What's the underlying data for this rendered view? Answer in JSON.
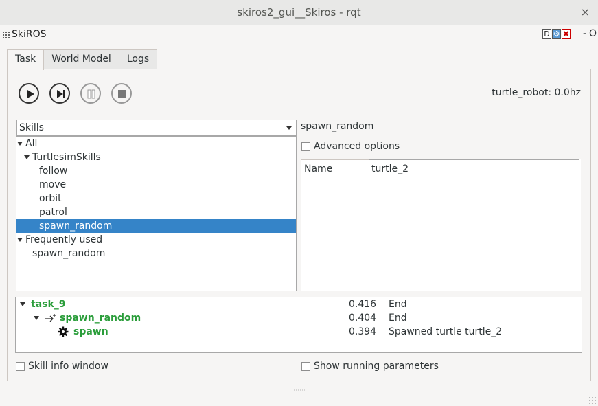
{
  "window": {
    "title": "skiros2_gui__Skiros - rqt",
    "close_glyph": "×"
  },
  "plugin": {
    "name": "SkiROS",
    "buttons": [
      "D",
      "⚙",
      "✖"
    ],
    "minimize_label": "-",
    "float_label": "O"
  },
  "tabs": [
    {
      "label": "Task",
      "active": true
    },
    {
      "label": "World Model",
      "active": false
    },
    {
      "label": "Logs",
      "active": false
    }
  ],
  "controls": {
    "play": "play-icon",
    "step": "step-forward-icon",
    "pause": "pause-icon",
    "stop": "stop-icon",
    "robot_status": "turtle_robot: 0.0hz"
  },
  "skills_panel": {
    "combo_value": "Skills",
    "tree": [
      {
        "label": "All",
        "level": 0,
        "expanded": true
      },
      {
        "label": "TurtlesimSkills",
        "level": 1,
        "expanded": true
      },
      {
        "label": "follow",
        "level": 2
      },
      {
        "label": "move",
        "level": 2
      },
      {
        "label": "orbit",
        "level": 2
      },
      {
        "label": "patrol",
        "level": 2
      },
      {
        "label": "spawn_random",
        "level": 2,
        "selected": true
      },
      {
        "label": "Frequently used",
        "level": 0,
        "expanded": true
      },
      {
        "label": "spawn_random",
        "level": 1
      }
    ]
  },
  "skill_params": {
    "skill_name": "spawn_random",
    "advanced_label": "Advanced options",
    "advanced_checked": false,
    "param_name": "Name",
    "param_value": "turtle_2"
  },
  "task_tree": {
    "rows": [
      {
        "name": "task_9",
        "time": "0.416",
        "message": "End"
      },
      {
        "name": "spawn_random",
        "time": "0.404",
        "message": "End",
        "icon": "sequence-arrow-icon"
      },
      {
        "name": "spawn",
        "time": "0.394",
        "message": "Spawned turtle turtle_2",
        "icon": "gear-icon"
      }
    ]
  },
  "footer": {
    "skill_info_label": "Skill info window",
    "running_params_label": "Show running parameters"
  },
  "colors": {
    "selection": "#3584c8",
    "task_green": "#2a9d3a"
  }
}
